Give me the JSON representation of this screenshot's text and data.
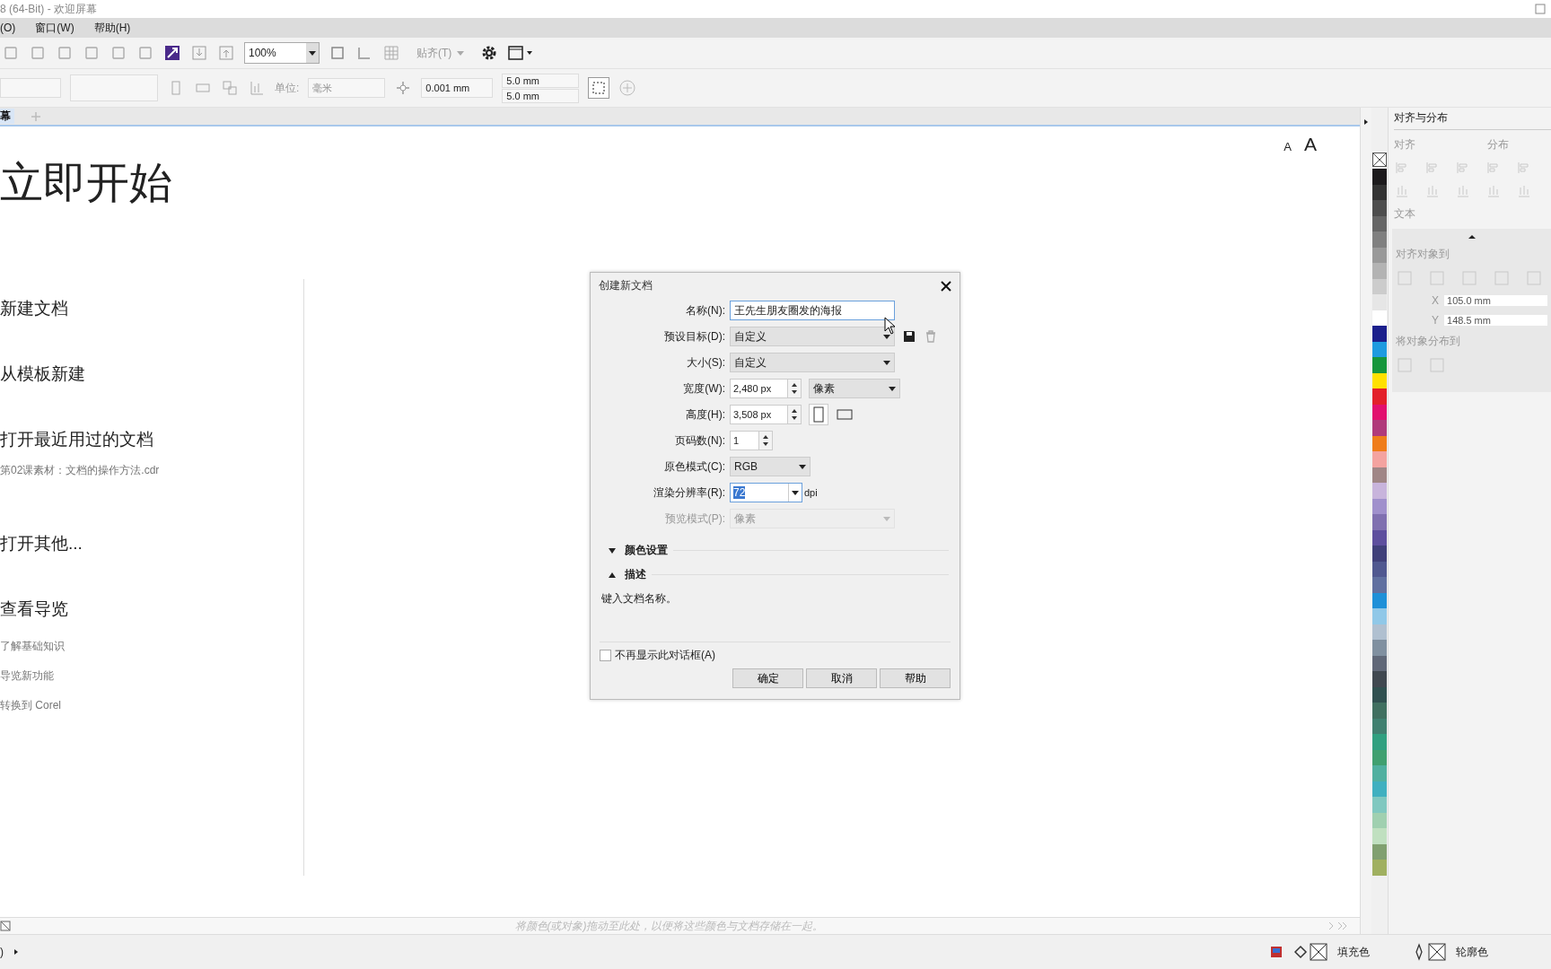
{
  "window": {
    "title": "8 (64-Bit) - 欢迎屏幕"
  },
  "menu": [
    {
      "label": "(O)"
    },
    {
      "label": "窗口(W)"
    },
    {
      "label": "帮助(H)"
    }
  ],
  "toolbar": {
    "zoom": "100%",
    "snap": "贴齐(T)"
  },
  "property_bar": {
    "units_label": "单位:",
    "units_value": "毫米",
    "nudge": "0.001 mm",
    "dup_x": "5.0 mm",
    "dup_y": "5.0 mm"
  },
  "tabs": [
    {
      "label": "幕",
      "selected": true
    }
  ],
  "welcome": {
    "size_small": "A",
    "size_large": "A",
    "heading": "立即开始",
    "items": [
      {
        "label": "新建文档",
        "kind": "action"
      },
      {
        "label": "从模板新建",
        "kind": "action"
      },
      {
        "label": "打开最近用过的文档",
        "kind": "action"
      },
      {
        "label": "第02课素材：文档的操作方法.cdr",
        "kind": "file"
      },
      {
        "label": "打开其他...",
        "kind": "action"
      },
      {
        "label": "查看导览",
        "kind": "action"
      },
      {
        "label": "了解基础知识",
        "kind": "link"
      },
      {
        "label": "导览新功能",
        "kind": "link"
      },
      {
        "label": "转换到 Corel",
        "kind": "link"
      }
    ]
  },
  "dialog": {
    "title": "创建新文档",
    "fields": [
      {
        "label": "名称(N):",
        "kind": "text",
        "value": "王先生朋友圈发的海报",
        "focused": true
      },
      {
        "label": "预设目标(D):",
        "kind": "preset",
        "value": "自定义"
      },
      {
        "label": "大小(S):",
        "kind": "select",
        "value": "自定义"
      },
      {
        "label": "宽度(W):",
        "kind": "spin-unit",
        "value": "2,480 px",
        "unit": "像素"
      },
      {
        "label": "高度(H):",
        "kind": "spin-orient",
        "value": "3,508 px"
      },
      {
        "label": "页码数(N):",
        "kind": "spin",
        "value": "1"
      },
      {
        "label": "原色模式(C):",
        "kind": "short-select",
        "value": "RGB"
      },
      {
        "label": "渲染分辨率(R):",
        "kind": "combo",
        "value": "72",
        "suffix": "dpi",
        "highlighted": true
      },
      {
        "label": "预览模式(P):",
        "kind": "select",
        "value": "像素",
        "disabled": true
      }
    ],
    "sections": [
      {
        "label": "颜色设置",
        "expanded": false
      },
      {
        "label": "描述",
        "expanded": true
      }
    ],
    "description": "键入文档名称。",
    "dont_show": {
      "label": "不再显示此对话框(A)",
      "checked": false
    },
    "buttons": [
      "确定",
      "取消",
      "帮助"
    ]
  },
  "docker": {
    "title": "对齐与分布",
    "align_label": "对齐",
    "distribute_label": "分布",
    "text_label": "文本",
    "align_to_label": "对齐对象到",
    "x_label": "X",
    "x": "105.0 mm",
    "y_label": "Y",
    "y": "148.5 mm",
    "distribute_to_label": "将对象分布到"
  },
  "palette": [
    {
      "color": "#1c1a1c"
    },
    {
      "color": "#333333"
    },
    {
      "color": "#4d4d4d"
    },
    {
      "color": "#666666"
    },
    {
      "color": "#808080"
    },
    {
      "color": "#999999"
    },
    {
      "color": "#b3b3b3"
    },
    {
      "color": "#cccccc"
    },
    {
      "color": "#e6e6e6"
    },
    {
      "color": "#ffffff"
    },
    {
      "color": "#1b1f8c"
    },
    {
      "color": "#1e9be0"
    },
    {
      "color": "#16963c"
    },
    {
      "color": "#ffe100"
    },
    {
      "color": "#e3202a"
    },
    {
      "color": "#e2106e"
    },
    {
      "color": "#b03a7a"
    },
    {
      "color": "#ef7d1a"
    },
    {
      "color": "#f4a3a0"
    },
    {
      "color": "#a08686"
    },
    {
      "color": "#c8b4dc"
    },
    {
      "color": "#a090cc"
    },
    {
      "color": "#8070b0"
    },
    {
      "color": "#5e4f9e"
    },
    {
      "color": "#40407a"
    },
    {
      "color": "#505890"
    },
    {
      "color": "#6070a0"
    },
    {
      "color": "#1e90d8"
    },
    {
      "color": "#90c8e8"
    },
    {
      "color": "#b0c0d0"
    },
    {
      "color": "#8090a0"
    },
    {
      "color": "#606878"
    },
    {
      "color": "#404850"
    },
    {
      "color": "#305050"
    },
    {
      "color": "#407060"
    },
    {
      "color": "#408070"
    },
    {
      "color": "#30a080"
    },
    {
      "color": "#40a070"
    },
    {
      "color": "#50b0a0"
    },
    {
      "color": "#40b0c0"
    },
    {
      "color": "#80c8c0"
    },
    {
      "color": "#a0d0b0"
    },
    {
      "color": "#c0e0c0"
    },
    {
      "color": "#80a070"
    },
    {
      "color": "#a0b060"
    }
  ],
  "hint": "将颜色(或对象)拖动至此处，以便将这些颜色与文档存储在一起。",
  "status_bar": {
    "left": ")",
    "fill": "填充色",
    "outline": "轮廓色"
  }
}
